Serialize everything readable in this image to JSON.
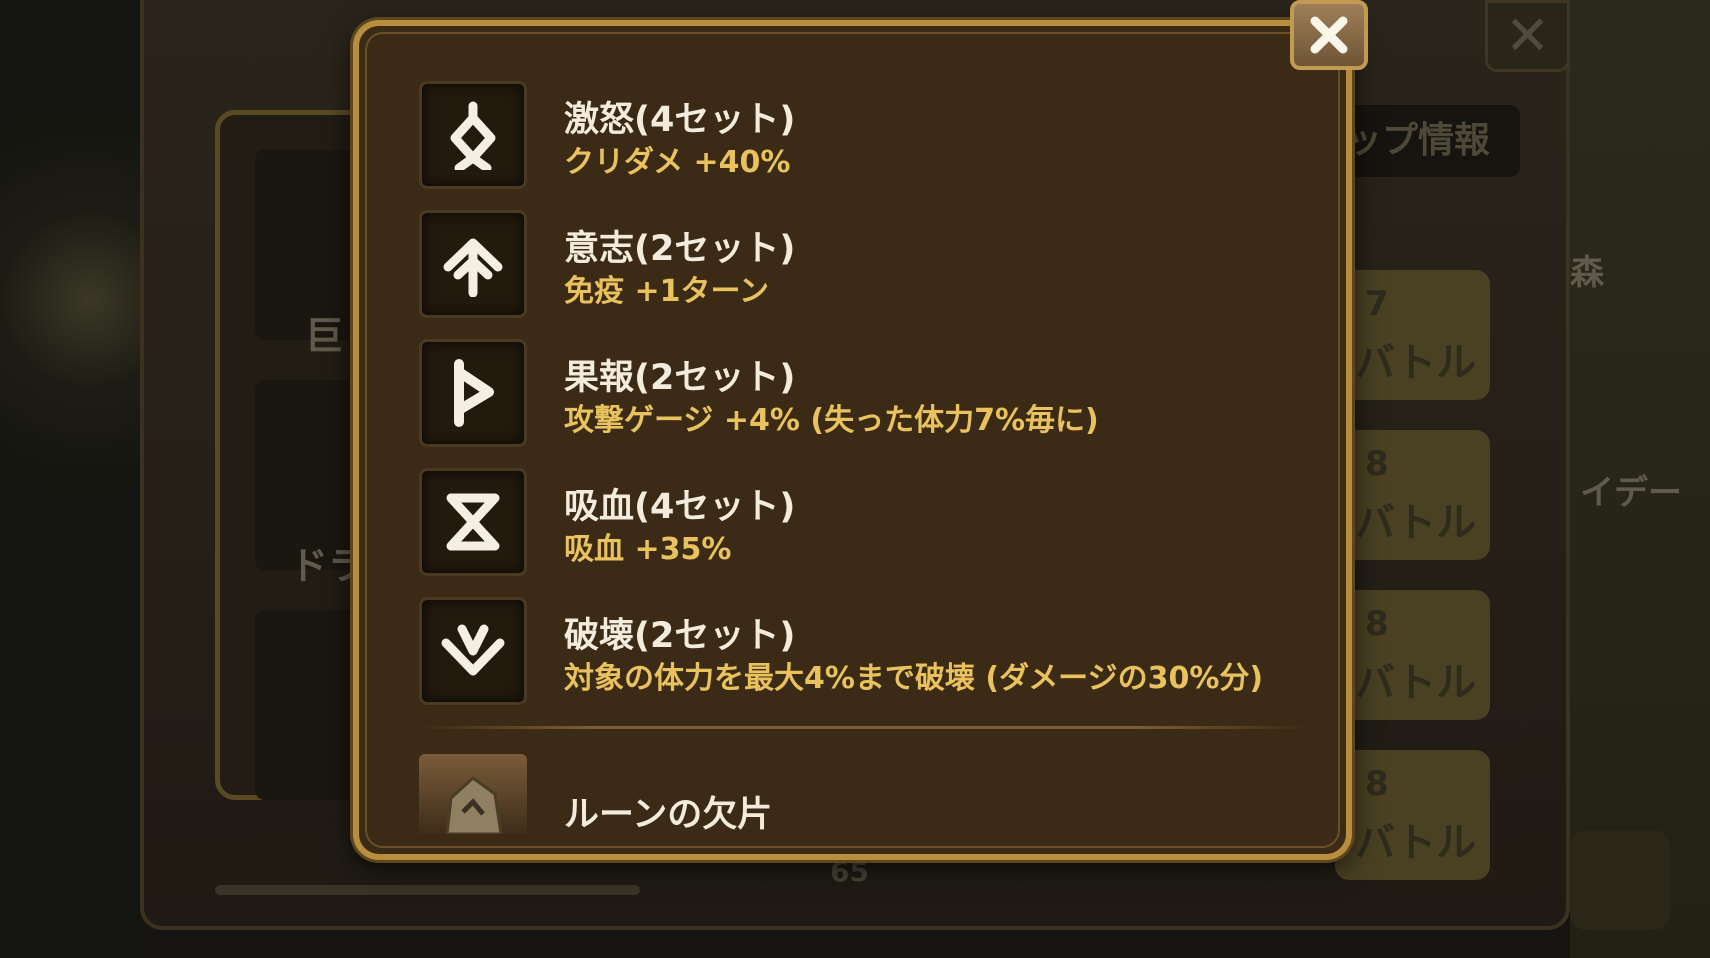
{
  "background": {
    "tab_label": "ップ情報",
    "partial_labels": [
      "巨",
      "ドラ",
      "森",
      "イデー"
    ],
    "battle_buttons": [
      {
        "energy": "7",
        "label": "バトル"
      },
      {
        "energy": "8",
        "label": "バトル"
      },
      {
        "energy": "8",
        "label": "バトル"
      },
      {
        "energy": "8",
        "label": "バトル"
      }
    ],
    "level_text": "65"
  },
  "popup": {
    "runes": [
      {
        "name": "激怒(4セット)",
        "effect": "クリダメ +40%",
        "icon": "rage-rune-icon"
      },
      {
        "name": "意志(2セット)",
        "effect": "免疫 +1ターン",
        "icon": "will-rune-icon"
      },
      {
        "name": "果報(2セット)",
        "effect": "攻撃ゲージ +4% (失った体力7%毎に)",
        "icon": "revenge-rune-icon"
      },
      {
        "name": "吸血(4セット)",
        "effect": "吸血 +35%",
        "icon": "vampire-rune-icon"
      },
      {
        "name": "破壊(2セット)",
        "effect": "対象の体力を最大4%まで破壊 (ダメージの30%分)",
        "icon": "destroy-rune-icon"
      }
    ],
    "fragment_label": "ルーンの欠片"
  },
  "colors": {
    "popup_bg": "#3a2a16",
    "popup_border": "#b88d3c",
    "name_text": "#f3ecdc",
    "effect_text": "#e9c25e"
  }
}
